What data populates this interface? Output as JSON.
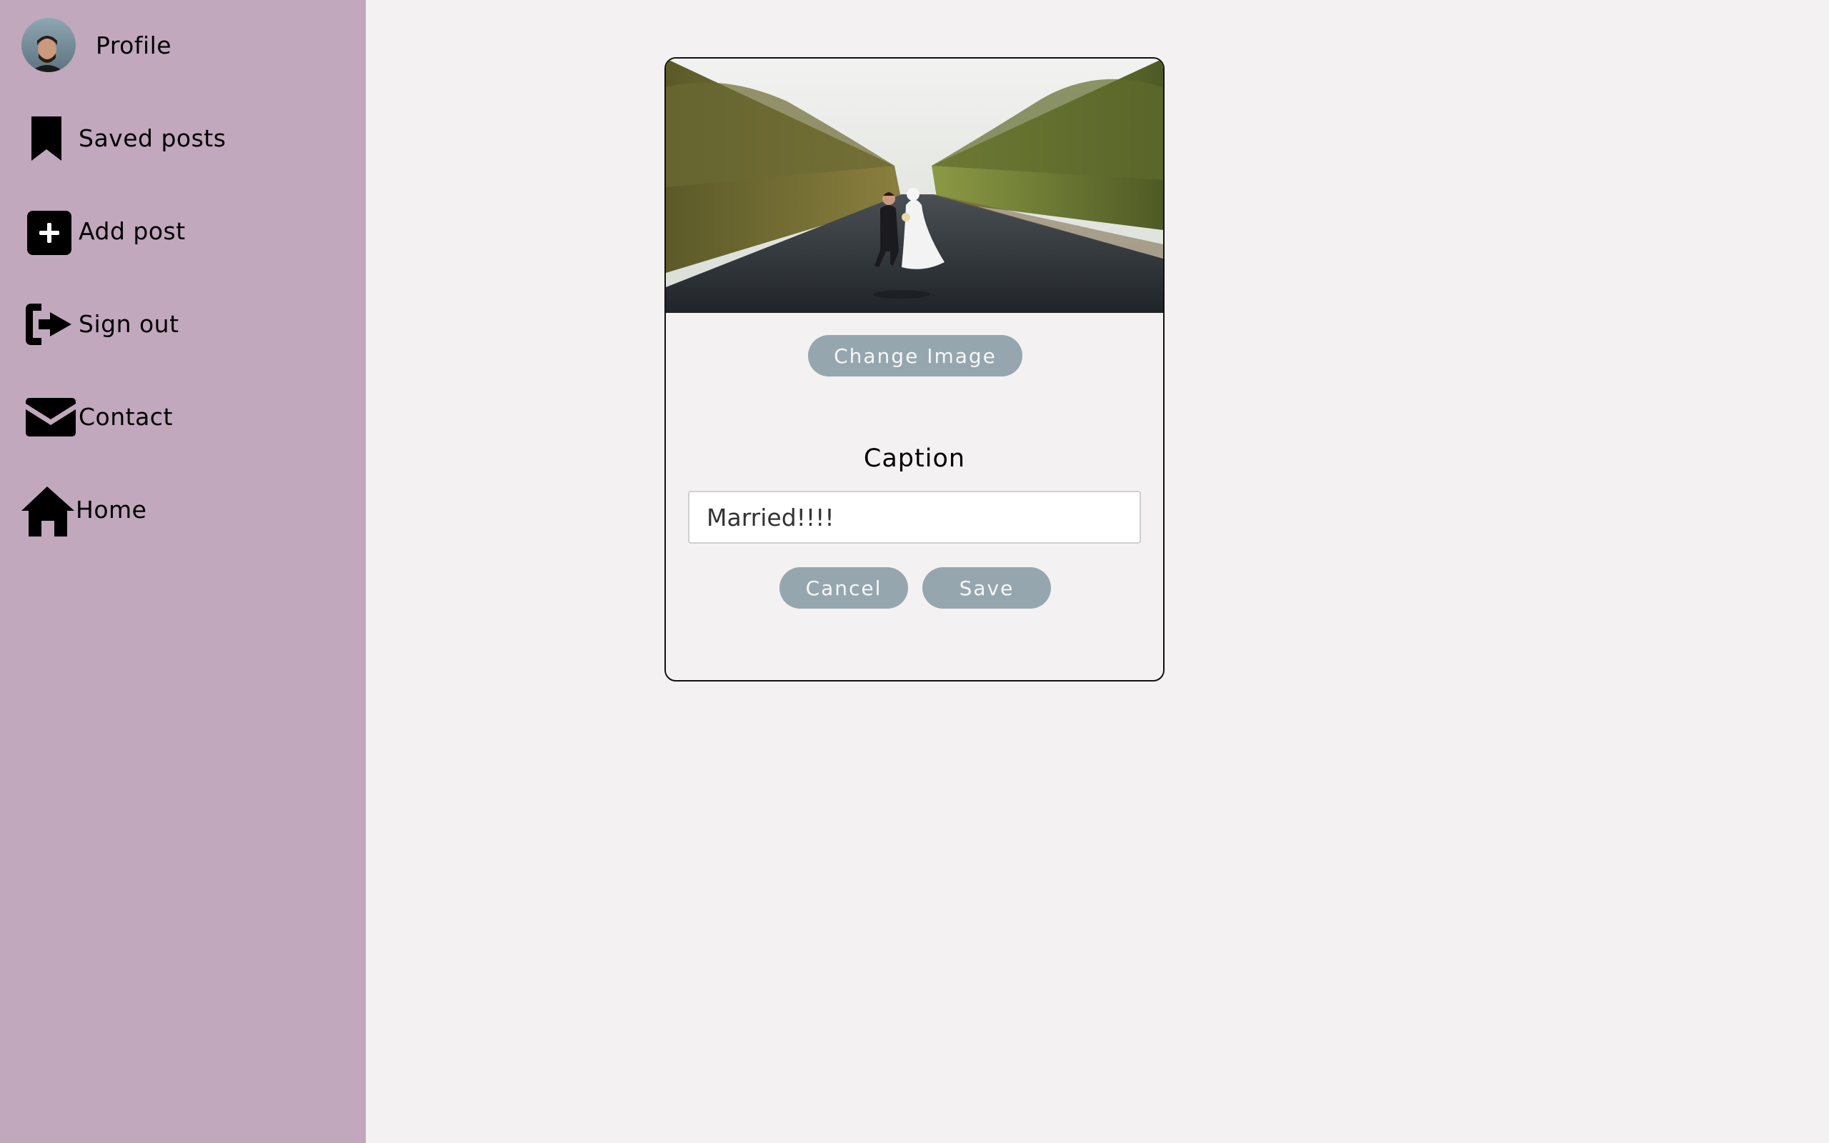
{
  "sidebar": {
    "items": [
      {
        "label": "Profile",
        "icon": "avatar"
      },
      {
        "label": "Saved posts",
        "icon": "bookmark-icon"
      },
      {
        "label": "Add post",
        "icon": "plus-square-icon"
      },
      {
        "label": "Sign out",
        "icon": "sign-out-icon"
      },
      {
        "label": "Contact",
        "icon": "envelope-icon"
      },
      {
        "label": "Home",
        "icon": "home-icon"
      }
    ],
    "background": "#c1a8bd"
  },
  "editor": {
    "change_image_label": "Change Image",
    "caption_label": "Caption",
    "caption_value": "Married!!!!",
    "cancel_label": "Cancel",
    "save_label": "Save",
    "button_color": "#95a6ae"
  }
}
